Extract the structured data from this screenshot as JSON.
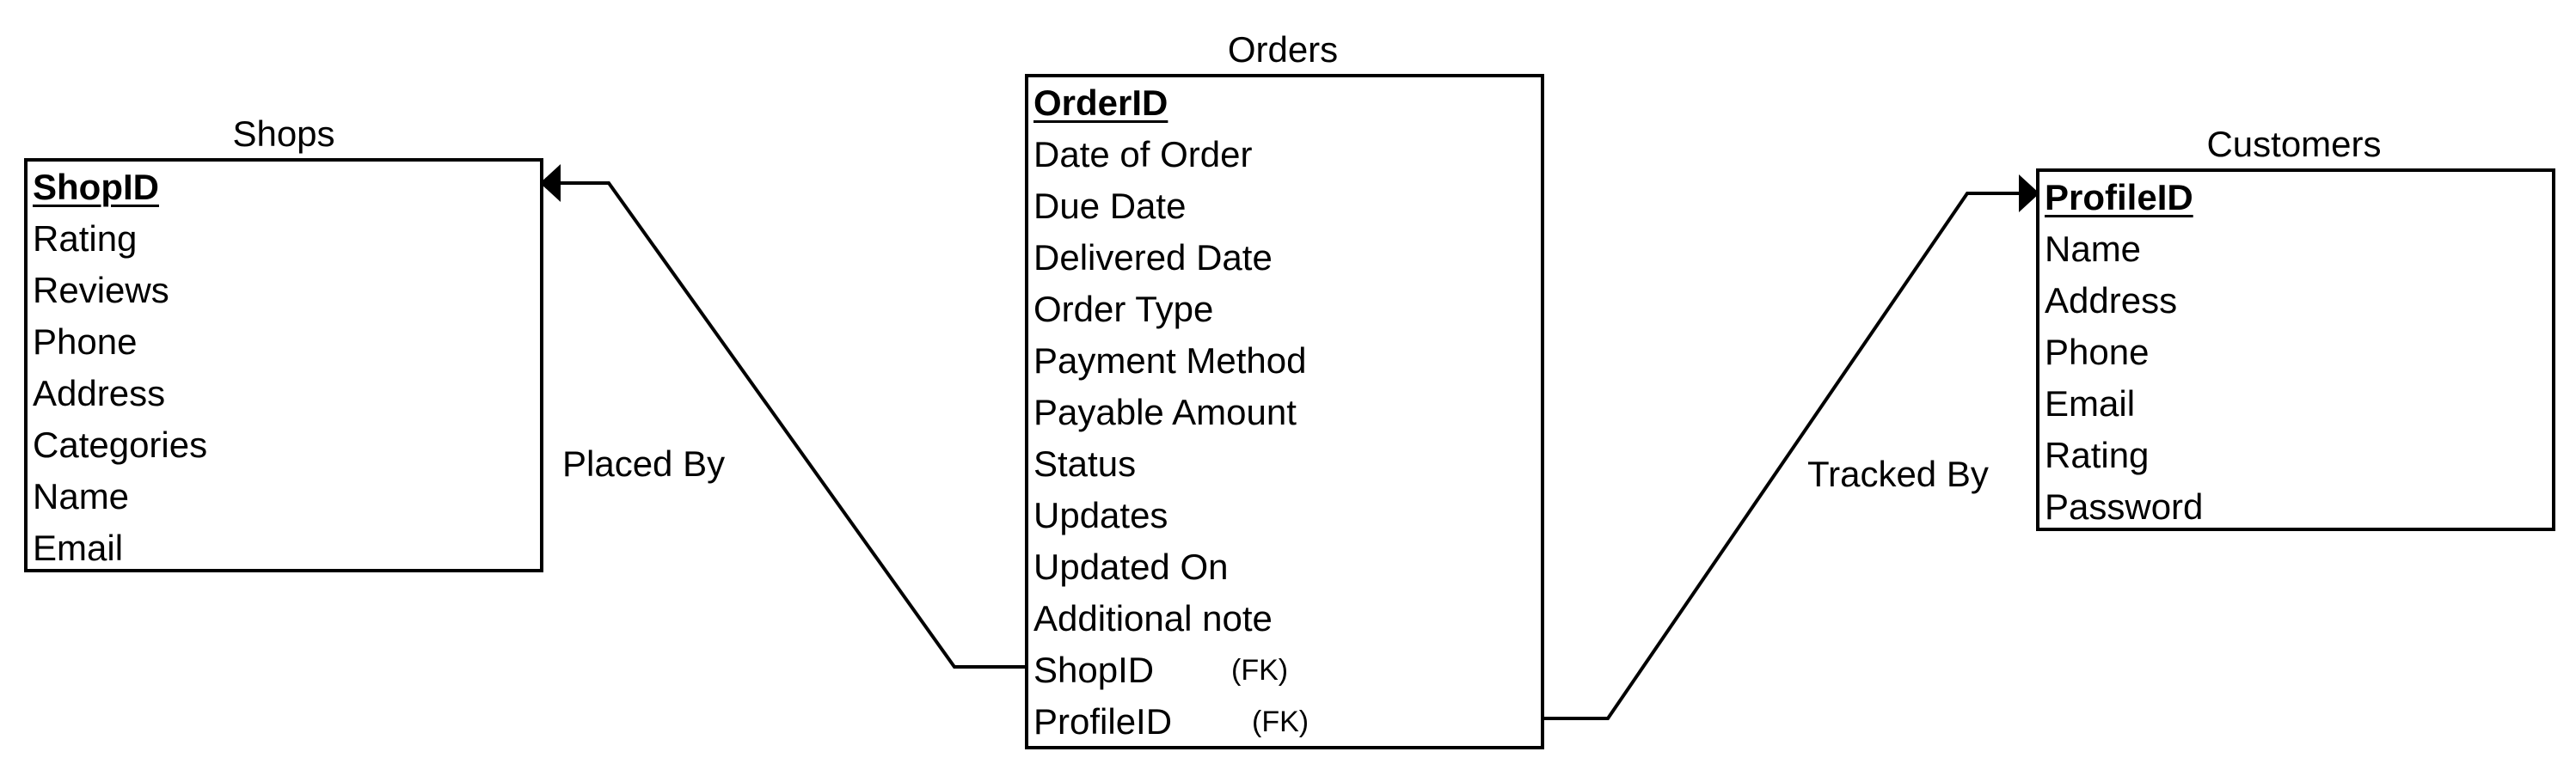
{
  "entities": {
    "shops": {
      "title": "Shops",
      "primary_key": "ShopID",
      "attributes": [
        "Rating",
        "Reviews",
        "Phone",
        "Address",
        "Categories",
        "Name",
        "Email"
      ]
    },
    "orders": {
      "title": "Orders",
      "primary_key": "OrderID",
      "attributes": [
        "Date of Order",
        "Due Date",
        "Delivered Date",
        "Order Type",
        "Payment Method",
        "Payable Amount",
        "Status",
        "Updates",
        "Updated On",
        "Additional note"
      ],
      "foreign_keys": [
        {
          "name": "ShopID",
          "tag": "(FK)"
        },
        {
          "name": "ProfileID",
          "tag": "(FK)"
        }
      ]
    },
    "customers": {
      "title": "Customers",
      "primary_key": "ProfileID",
      "attributes": [
        "Name",
        "Address",
        "Phone",
        "Email",
        "Rating",
        "Password"
      ]
    }
  },
  "relationships": [
    {
      "label": "Placed By",
      "from": "orders.ShopID",
      "to": "shops.ShopID"
    },
    {
      "label": "Tracked By",
      "from": "orders.ProfileID",
      "to": "customers.ProfileID"
    }
  ]
}
